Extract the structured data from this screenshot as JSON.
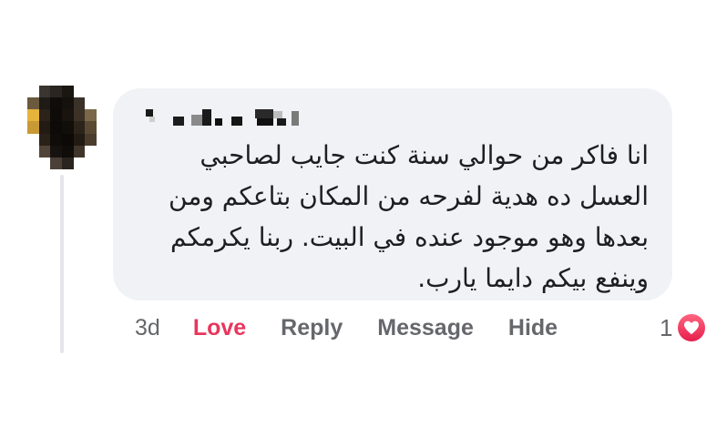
{
  "comment": {
    "author_name_obscured": true,
    "avatar_obscured": true,
    "lines": [
      "انا فاكر من حوالي سنة كنت جايب لصاحبي",
      "العسل ده هدية  لفرحه من المكان بتاعكم ومن",
      "بعدها وهو موجود عنده في البيت. ربنا يكرمكم",
      "وينفع بيكم دايما يارب."
    ]
  },
  "actions": {
    "time": "3d",
    "love": "Love",
    "reply": "Reply",
    "message": "Message",
    "hide": "Hide"
  },
  "reaction": {
    "count": "1",
    "icon": "heart-icon",
    "color": "#e8365d"
  },
  "colors": {
    "bubble": "#f0f2f5",
    "text": "#1c1e21",
    "muted": "#65676b",
    "love": "#e8365d"
  }
}
